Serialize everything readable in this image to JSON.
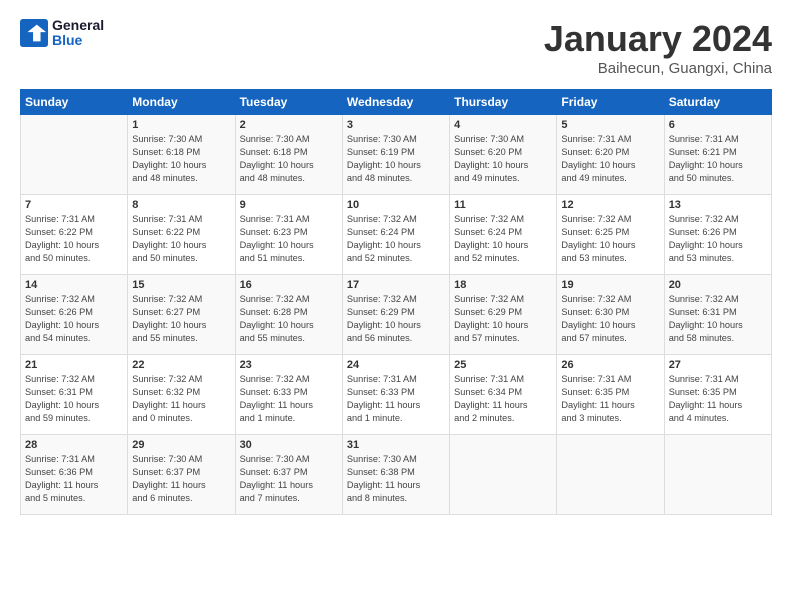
{
  "logo": {
    "line1": "General",
    "line2": "Blue"
  },
  "title": "January 2024",
  "location": "Baihecun, Guangxi, China",
  "headers": [
    "Sunday",
    "Monday",
    "Tuesday",
    "Wednesday",
    "Thursday",
    "Friday",
    "Saturday"
  ],
  "weeks": [
    [
      {
        "day": "",
        "text": ""
      },
      {
        "day": "1",
        "text": "Sunrise: 7:30 AM\nSunset: 6:18 PM\nDaylight: 10 hours\nand 48 minutes."
      },
      {
        "day": "2",
        "text": "Sunrise: 7:30 AM\nSunset: 6:18 PM\nDaylight: 10 hours\nand 48 minutes."
      },
      {
        "day": "3",
        "text": "Sunrise: 7:30 AM\nSunset: 6:19 PM\nDaylight: 10 hours\nand 48 minutes."
      },
      {
        "day": "4",
        "text": "Sunrise: 7:30 AM\nSunset: 6:20 PM\nDaylight: 10 hours\nand 49 minutes."
      },
      {
        "day": "5",
        "text": "Sunrise: 7:31 AM\nSunset: 6:20 PM\nDaylight: 10 hours\nand 49 minutes."
      },
      {
        "day": "6",
        "text": "Sunrise: 7:31 AM\nSunset: 6:21 PM\nDaylight: 10 hours\nand 50 minutes."
      }
    ],
    [
      {
        "day": "7",
        "text": "Sunrise: 7:31 AM\nSunset: 6:22 PM\nDaylight: 10 hours\nand 50 minutes."
      },
      {
        "day": "8",
        "text": "Sunrise: 7:31 AM\nSunset: 6:22 PM\nDaylight: 10 hours\nand 50 minutes."
      },
      {
        "day": "9",
        "text": "Sunrise: 7:31 AM\nSunset: 6:23 PM\nDaylight: 10 hours\nand 51 minutes."
      },
      {
        "day": "10",
        "text": "Sunrise: 7:32 AM\nSunset: 6:24 PM\nDaylight: 10 hours\nand 52 minutes."
      },
      {
        "day": "11",
        "text": "Sunrise: 7:32 AM\nSunset: 6:24 PM\nDaylight: 10 hours\nand 52 minutes."
      },
      {
        "day": "12",
        "text": "Sunrise: 7:32 AM\nSunset: 6:25 PM\nDaylight: 10 hours\nand 53 minutes."
      },
      {
        "day": "13",
        "text": "Sunrise: 7:32 AM\nSunset: 6:26 PM\nDaylight: 10 hours\nand 53 minutes."
      }
    ],
    [
      {
        "day": "14",
        "text": "Sunrise: 7:32 AM\nSunset: 6:26 PM\nDaylight: 10 hours\nand 54 minutes."
      },
      {
        "day": "15",
        "text": "Sunrise: 7:32 AM\nSunset: 6:27 PM\nDaylight: 10 hours\nand 55 minutes."
      },
      {
        "day": "16",
        "text": "Sunrise: 7:32 AM\nSunset: 6:28 PM\nDaylight: 10 hours\nand 55 minutes."
      },
      {
        "day": "17",
        "text": "Sunrise: 7:32 AM\nSunset: 6:29 PM\nDaylight: 10 hours\nand 56 minutes."
      },
      {
        "day": "18",
        "text": "Sunrise: 7:32 AM\nSunset: 6:29 PM\nDaylight: 10 hours\nand 57 minutes."
      },
      {
        "day": "19",
        "text": "Sunrise: 7:32 AM\nSunset: 6:30 PM\nDaylight: 10 hours\nand 57 minutes."
      },
      {
        "day": "20",
        "text": "Sunrise: 7:32 AM\nSunset: 6:31 PM\nDaylight: 10 hours\nand 58 minutes."
      }
    ],
    [
      {
        "day": "21",
        "text": "Sunrise: 7:32 AM\nSunset: 6:31 PM\nDaylight: 10 hours\nand 59 minutes."
      },
      {
        "day": "22",
        "text": "Sunrise: 7:32 AM\nSunset: 6:32 PM\nDaylight: 11 hours\nand 0 minutes."
      },
      {
        "day": "23",
        "text": "Sunrise: 7:32 AM\nSunset: 6:33 PM\nDaylight: 11 hours\nand 1 minute."
      },
      {
        "day": "24",
        "text": "Sunrise: 7:31 AM\nSunset: 6:33 PM\nDaylight: 11 hours\nand 1 minute."
      },
      {
        "day": "25",
        "text": "Sunrise: 7:31 AM\nSunset: 6:34 PM\nDaylight: 11 hours\nand 2 minutes."
      },
      {
        "day": "26",
        "text": "Sunrise: 7:31 AM\nSunset: 6:35 PM\nDaylight: 11 hours\nand 3 minutes."
      },
      {
        "day": "27",
        "text": "Sunrise: 7:31 AM\nSunset: 6:35 PM\nDaylight: 11 hours\nand 4 minutes."
      }
    ],
    [
      {
        "day": "28",
        "text": "Sunrise: 7:31 AM\nSunset: 6:36 PM\nDaylight: 11 hours\nand 5 minutes."
      },
      {
        "day": "29",
        "text": "Sunrise: 7:30 AM\nSunset: 6:37 PM\nDaylight: 11 hours\nand 6 minutes."
      },
      {
        "day": "30",
        "text": "Sunrise: 7:30 AM\nSunset: 6:37 PM\nDaylight: 11 hours\nand 7 minutes."
      },
      {
        "day": "31",
        "text": "Sunrise: 7:30 AM\nSunset: 6:38 PM\nDaylight: 11 hours\nand 8 minutes."
      },
      {
        "day": "",
        "text": ""
      },
      {
        "day": "",
        "text": ""
      },
      {
        "day": "",
        "text": ""
      }
    ]
  ]
}
